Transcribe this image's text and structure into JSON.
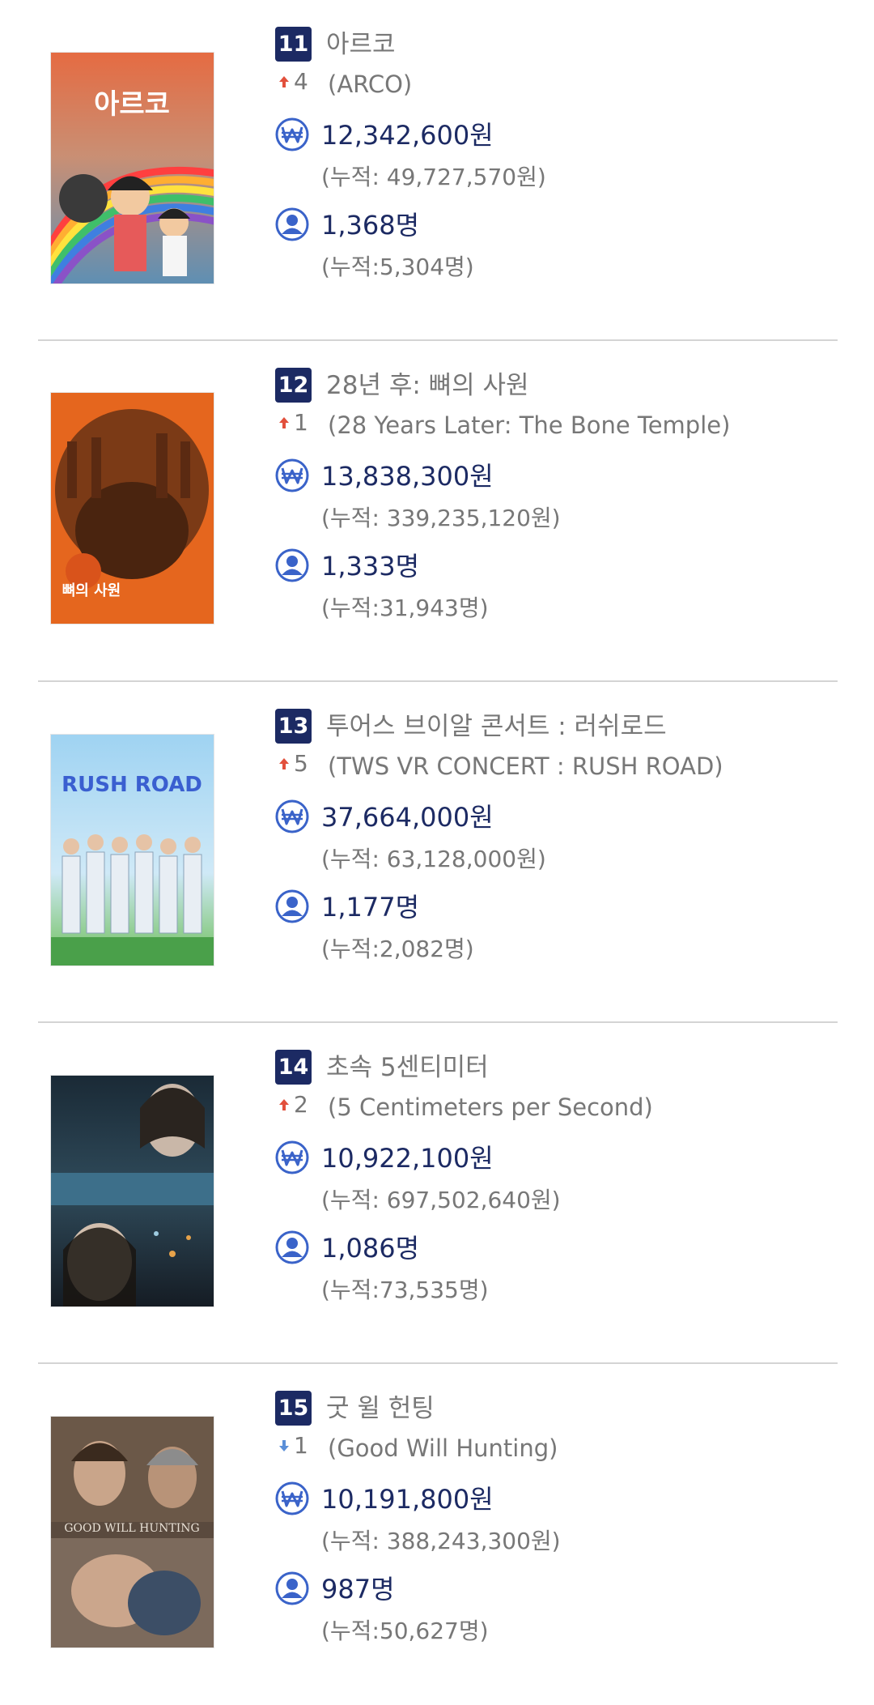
{
  "colors": {
    "rank_badge": "#1c2a63",
    "value_text": "#1c2a63",
    "muted_text": "#777777",
    "icon_blue": "#3a63c9",
    "arrow_up": "#e2503c",
    "arrow_down": "#5b8fd8",
    "divider": "#d4d4d4"
  },
  "movies": [
    {
      "rank": "11",
      "title": "아르코",
      "change_dir": "up",
      "change_icon": "arrow-up-icon",
      "change": "4",
      "original_title": "(ARCO)",
      "sales": "12,342,600원",
      "sales_cumulative": "(누적: 49,727,570원)",
      "audience": "1,368명",
      "audience_cumulative": "(누적:5,304명)",
      "poster_title": "아르코"
    },
    {
      "rank": "12",
      "title": "28년 후: 뼈의 사원",
      "change_dir": "up",
      "change_icon": "arrow-up-icon",
      "change": "1",
      "original_title": "(28 Years Later: The Bone Temple)",
      "sales": "13,838,300원",
      "sales_cumulative": "(누적: 339,235,120원)",
      "audience": "1,333명",
      "audience_cumulative": "(누적:31,943명)",
      "poster_title": "뼈의 사원"
    },
    {
      "rank": "13",
      "title": "투어스 브이알 콘서트 : 러쉬로드",
      "change_dir": "up",
      "change_icon": "arrow-up-icon",
      "change": "5",
      "original_title": "(TWS VR CONCERT : RUSH ROAD)",
      "sales": "37,664,000원",
      "sales_cumulative": "(누적: 63,128,000원)",
      "audience": "1,177명",
      "audience_cumulative": "(누적:2,082명)",
      "poster_title": "RUSH ROAD"
    },
    {
      "rank": "14",
      "title": "초속 5센티미터",
      "change_dir": "up",
      "change_icon": "arrow-up-icon",
      "change": "2",
      "original_title": "(5 Centimeters per Second)",
      "sales": "10,922,100원",
      "sales_cumulative": "(누적: 697,502,640원)",
      "audience": "1,086명",
      "audience_cumulative": "(누적:73,535명)",
      "poster_title": ""
    },
    {
      "rank": "15",
      "title": "굿 윌 헌팅",
      "change_dir": "down",
      "change_icon": "arrow-down-icon",
      "change": "1",
      "original_title": "(Good Will Hunting)",
      "sales": "10,191,800원",
      "sales_cumulative": "(누적: 388,243,300원)",
      "audience": "987명",
      "audience_cumulative": "(누적:50,627명)",
      "poster_title": "GOOD WILL HUNTING"
    }
  ]
}
